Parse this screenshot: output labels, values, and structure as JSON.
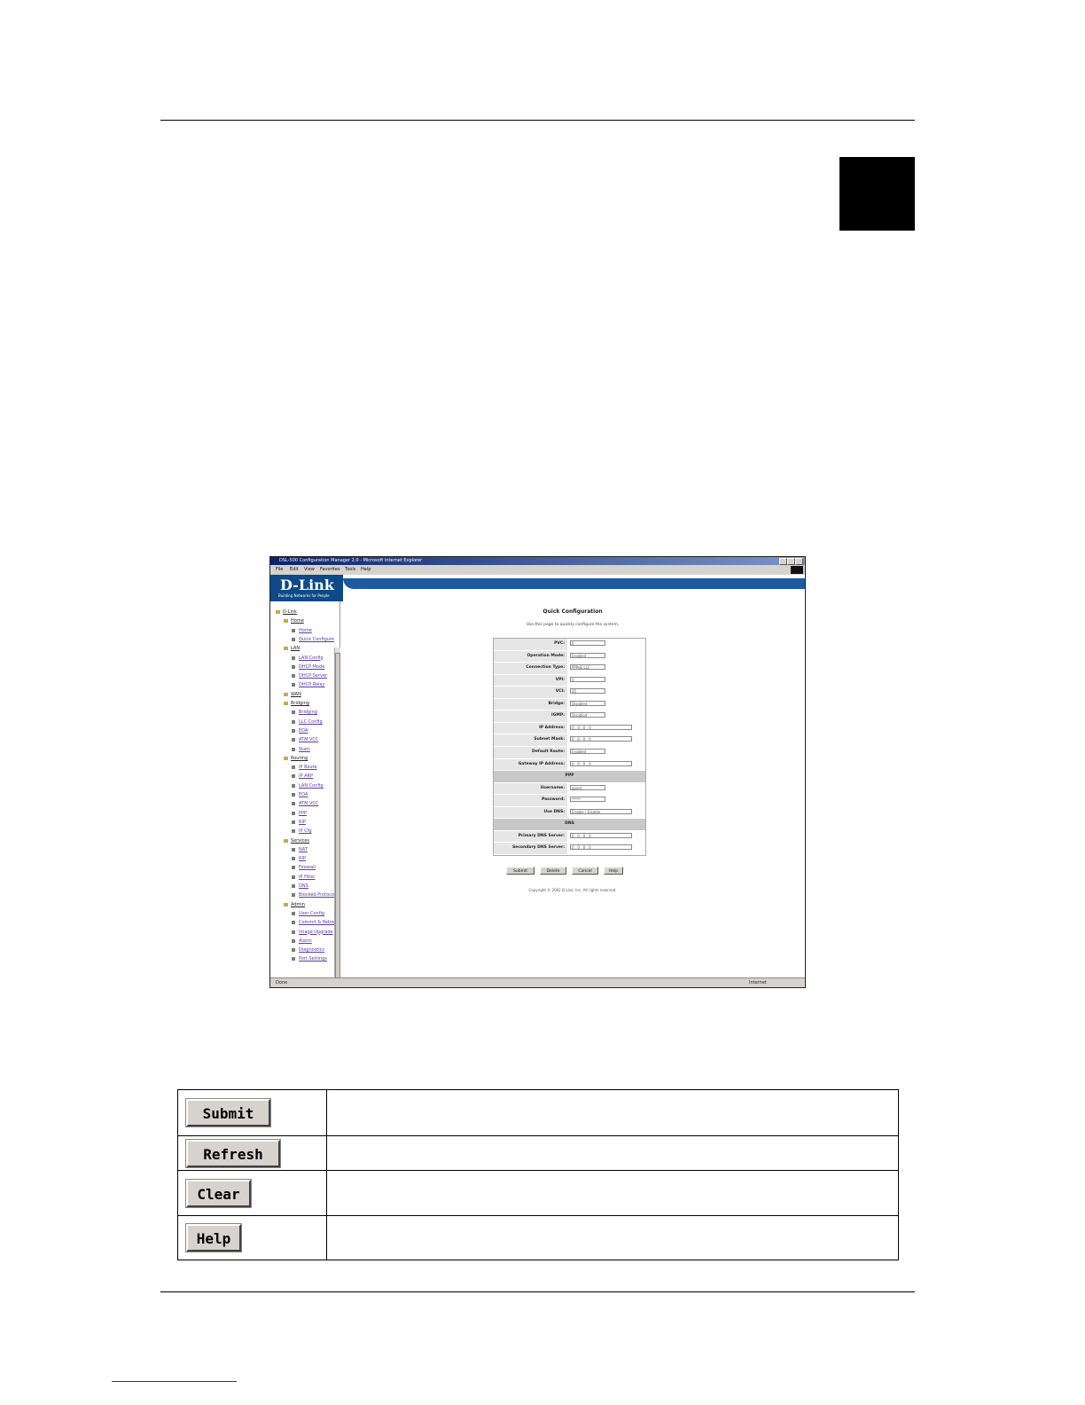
{
  "screenshot": {
    "window_title": "DSL-500 Configuration Manager 2.0 - Microsoft Internet Explorer",
    "menu": [
      "File",
      "Edit",
      "View",
      "Favorites",
      "Tools",
      "Help"
    ],
    "logo_text": "D-Link",
    "logo_tagline": "Building Networks for People",
    "tree": [
      {
        "label": "D-Link",
        "level": 0,
        "folder": true
      },
      {
        "label": "Home",
        "level": 1,
        "folder": true
      },
      {
        "label": "Home",
        "level": 2,
        "folder": false
      },
      {
        "label": "Quick Configure",
        "level": 2,
        "folder": false
      },
      {
        "label": "LAN",
        "level": 1,
        "folder": true
      },
      {
        "label": "LAN Config",
        "level": 2,
        "folder": false
      },
      {
        "label": "DHCP Mode",
        "level": 2,
        "folder": false
      },
      {
        "label": "DHCP Server",
        "level": 2,
        "folder": false
      },
      {
        "label": "DHCP Relay",
        "level": 2,
        "folder": false
      },
      {
        "label": "WAN",
        "level": 1,
        "folder": true
      },
      {
        "label": "Bridging",
        "level": 1,
        "folder": true
      },
      {
        "label": "Bridging",
        "level": 2,
        "folder": false
      },
      {
        "label": "LLC Config",
        "level": 2,
        "folder": false
      },
      {
        "label": "EOA",
        "level": 2,
        "folder": false
      },
      {
        "label": "ATM VCC",
        "level": 2,
        "folder": false
      },
      {
        "label": "Stats",
        "level": 2,
        "folder": false
      },
      {
        "label": "Routing",
        "level": 1,
        "folder": true
      },
      {
        "label": "IP Route",
        "level": 2,
        "folder": false
      },
      {
        "label": "IP ARP",
        "level": 2,
        "folder": false
      },
      {
        "label": "LAN Config",
        "level": 2,
        "folder": false
      },
      {
        "label": "EOA",
        "level": 2,
        "folder": false
      },
      {
        "label": "ATM VCC",
        "level": 2,
        "folder": false
      },
      {
        "label": "PPP",
        "level": 2,
        "folder": false
      },
      {
        "label": "RIP",
        "level": 2,
        "folder": false
      },
      {
        "label": "IP Cfg",
        "level": 2,
        "folder": false
      },
      {
        "label": "Services",
        "level": 1,
        "folder": true
      },
      {
        "label": "NAT",
        "level": 2,
        "folder": false
      },
      {
        "label": "RIP",
        "level": 2,
        "folder": false
      },
      {
        "label": "Firewall",
        "level": 2,
        "folder": false
      },
      {
        "label": "IP Filter",
        "level": 2,
        "folder": false
      },
      {
        "label": "DNS",
        "level": 2,
        "folder": false
      },
      {
        "label": "Blocked Protocols",
        "level": 2,
        "folder": false
      },
      {
        "label": "Admin",
        "level": 1,
        "folder": true
      },
      {
        "label": "User Config",
        "level": 2,
        "folder": false
      },
      {
        "label": "Commit & Reboot",
        "level": 2,
        "folder": false
      },
      {
        "label": "Image Upgrade",
        "level": 2,
        "folder": false
      },
      {
        "label": "Alarm",
        "level": 2,
        "folder": false
      },
      {
        "label": "Diagnostics",
        "level": 2,
        "folder": false
      },
      {
        "label": "Port Settings",
        "level": 2,
        "folder": false
      }
    ],
    "page_title": "Quick Configuration",
    "page_subtitle": "Use this page to quickly configure the system.",
    "form_rows": [
      {
        "type": "field",
        "label": "PVC:",
        "value": "0"
      },
      {
        "type": "field",
        "label": "Operation Mode:",
        "value": "Enabled"
      },
      {
        "type": "field",
        "label": "Connection Type:",
        "value": "PPPoE LLC"
      },
      {
        "type": "field",
        "label": "VPI:",
        "value": "0"
      },
      {
        "type": "field",
        "label": "VCI:",
        "value": "35"
      },
      {
        "type": "field",
        "label": "Bridge:",
        "value": "Disabled"
      },
      {
        "type": "field",
        "label": "IGMP:",
        "value": "Disabled"
      },
      {
        "type": "field",
        "label": "IP Address:",
        "value": "0 . 0 . 0 . 0"
      },
      {
        "type": "field",
        "label": "Subnet Mask:",
        "value": "0 . 0 . 0 . 0"
      },
      {
        "type": "field",
        "label": "Default Route:",
        "value": "Enabled"
      },
      {
        "type": "field",
        "label": "Gateway IP Address:",
        "value": "0 . 0 . 0 . 0"
      },
      {
        "type": "section",
        "label": "PPP"
      },
      {
        "type": "field",
        "label": "Username:",
        "value": "guest"
      },
      {
        "type": "field",
        "label": "Password:",
        "value": "*****"
      },
      {
        "type": "field",
        "label": "Use DNS:",
        "value": "Enable / Disable"
      },
      {
        "type": "section",
        "label": "DNS"
      },
      {
        "type": "field",
        "label": "Primary DNS Server:",
        "value": "0 . 0 . 0 . 0"
      },
      {
        "type": "field",
        "label": "Secondary DNS Server:",
        "value": "0 . 0 . 0 . 0"
      }
    ],
    "buttons": [
      "Submit",
      "Delete",
      "Cancel",
      "Help"
    ],
    "copyright": "Copyright © 2002 D-Link, Inc. All rights reserved.",
    "status_left": "Done",
    "status_right": "Internet"
  },
  "button_table": [
    {
      "label": "Submit",
      "description": ""
    },
    {
      "label": "Refresh",
      "description": ""
    },
    {
      "label": "Clear",
      "description": ""
    },
    {
      "label": "Help",
      "description": ""
    }
  ]
}
